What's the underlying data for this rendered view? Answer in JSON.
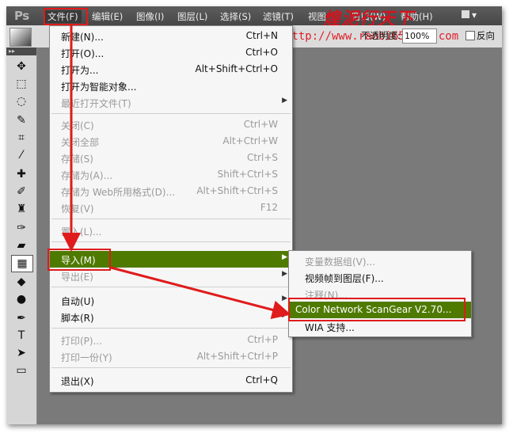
{
  "app": {
    "logo": "Ps",
    "menus": [
      "文件(F)",
      "编辑(E)",
      "图像(I)",
      "图层(L)",
      "选择(S)",
      "滤镜(T)",
      "视图",
      "窗口(W)",
      "帮助(H)"
    ],
    "menu_extra": "▾",
    "watermark_text": "煌泥行天下",
    "watermark_url": "http://www.ranbi654321.com"
  },
  "options": {
    "opacity_label": "不透明度:",
    "opacity_value": "100%",
    "reverse_label": "反向"
  },
  "file_menu": {
    "items": [
      {
        "label": "新建(N)...",
        "shortcut": "Ctrl+N",
        "disabled": false
      },
      {
        "label": "打开(O)...",
        "shortcut": "Ctrl+O",
        "disabled": false
      },
      {
        "label": "打开为...",
        "shortcut": "Alt+Shift+Ctrl+O",
        "disabled": false
      },
      {
        "label": "打开为智能对象...",
        "shortcut": "",
        "disabled": false
      },
      {
        "label": "最近打开文件(T)",
        "shortcut": "",
        "disabled": true,
        "submenu": true
      },
      {
        "label": "关闭(C)",
        "shortcut": "Ctrl+W",
        "disabled": true
      },
      {
        "label": "关闭全部",
        "shortcut": "Alt+Ctrl+W",
        "disabled": true
      },
      {
        "label": "存储(S)",
        "shortcut": "Ctrl+S",
        "disabled": true
      },
      {
        "label": "存储为(A)...",
        "shortcut": "Shift+Ctrl+S",
        "disabled": true
      },
      {
        "label": "存储为 Web所用格式(D)...",
        "shortcut": "Alt+Shift+Ctrl+S",
        "disabled": true
      },
      {
        "label": "恢复(V)",
        "shortcut": "F12",
        "disabled": true
      },
      {
        "label": "置入(L)...",
        "shortcut": "",
        "disabled": true
      },
      {
        "label": "导入(M)",
        "shortcut": "",
        "disabled": false,
        "submenu": true,
        "highlighted": true
      },
      {
        "label": "导出(E)",
        "shortcut": "",
        "disabled": true,
        "submenu": true
      },
      {
        "label": "自动(U)",
        "shortcut": "",
        "disabled": false,
        "submenu": true
      },
      {
        "label": "脚本(R)",
        "shortcut": "",
        "disabled": false,
        "submenu": true
      },
      {
        "label": "打印(P)...",
        "shortcut": "Ctrl+P",
        "disabled": true
      },
      {
        "label": "打印一份(Y)",
        "shortcut": "Alt+Shift+Ctrl+P",
        "disabled": true
      },
      {
        "label": "退出(X)",
        "shortcut": "Ctrl+Q",
        "disabled": false
      }
    ]
  },
  "import_submenu": {
    "items": [
      {
        "label": "变量数据组(V)...",
        "disabled": true
      },
      {
        "label": "视频帧到图层(F)...",
        "disabled": false
      },
      {
        "label": "注释(N)...",
        "disabled": true
      },
      {
        "label": "Color Network ScanGear V2.70...",
        "disabled": false,
        "highlighted": true
      },
      {
        "label": "WIA 支持...",
        "disabled": false
      }
    ]
  },
  "tools": [
    "move-icon",
    "marquee-icon",
    "lasso-icon",
    "quick-select-icon",
    "crop-icon",
    "eyedropper-icon",
    "healing-icon",
    "brush-icon",
    "stamp-icon",
    "history-brush-icon",
    "eraser-icon",
    "gradient-icon",
    "blur-icon",
    "dodge-icon",
    "pen-icon",
    "type-icon",
    "path-select-icon",
    "shape-icon"
  ],
  "colors": {
    "highlight": "#4f7a00",
    "annotation": "#e01b1b"
  }
}
